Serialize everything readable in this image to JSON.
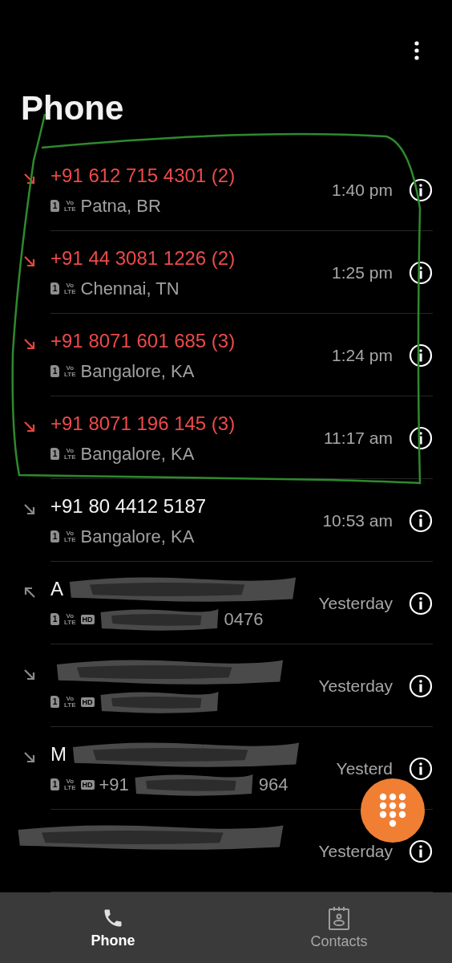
{
  "header": {
    "title": "Phone"
  },
  "calls": [
    {
      "kind": "incoming",
      "missed": true,
      "number": "+91 612 715 4301 (2)",
      "sim": "1",
      "network": [
        "Vo",
        "LTE"
      ],
      "location": "Patna, BR",
      "time": "1:40 pm"
    },
    {
      "kind": "incoming",
      "missed": true,
      "number": "+91 44 3081 1226 (2)",
      "sim": "1",
      "network": [
        "Vo",
        "LTE"
      ],
      "location": "Chennai, TN",
      "time": "1:25 pm"
    },
    {
      "kind": "incoming",
      "missed": true,
      "number": "+91 8071 601 685 (3)",
      "sim": "1",
      "network": [
        "Vo",
        "LTE"
      ],
      "location": "Bangalore, KA",
      "time": "1:24 pm"
    },
    {
      "kind": "incoming",
      "missed": true,
      "number": "+91 8071 196 145 (3)",
      "sim": "1",
      "network": [
        "Vo",
        "LTE"
      ],
      "location": "Bangalore, KA",
      "time": "11:17 am"
    },
    {
      "kind": "incoming",
      "missed": false,
      "number": "+91 80 4412 5187",
      "sim": "1",
      "network": [
        "Vo",
        "LTE"
      ],
      "location": "Bangalore, KA",
      "time": "10:53 am"
    },
    {
      "kind": "outgoing",
      "missed": false,
      "redacted": true,
      "number": "A",
      "sim": "1",
      "network": [
        "Vo",
        "LTE"
      ],
      "hd": "HD",
      "location_tail": "0476",
      "time": "Yesterday"
    },
    {
      "kind": "incoming",
      "missed": false,
      "redacted": true,
      "sim": "1",
      "network": [
        "Vo",
        "LTE"
      ],
      "hd": "HD",
      "time": "Yesterday"
    },
    {
      "kind": "incoming",
      "missed": false,
      "redacted": true,
      "number": "M",
      "sim": "1",
      "network": [
        "Vo",
        "LTE"
      ],
      "hd": "HD",
      "location_head": "+91",
      "location_tail": "964",
      "time": "Yesterd"
    },
    {
      "redacted": true,
      "time": "Yesterday"
    }
  ],
  "tabs": [
    {
      "label": "Phone",
      "selected": true
    },
    {
      "label": "Contacts",
      "selected": false
    }
  ]
}
